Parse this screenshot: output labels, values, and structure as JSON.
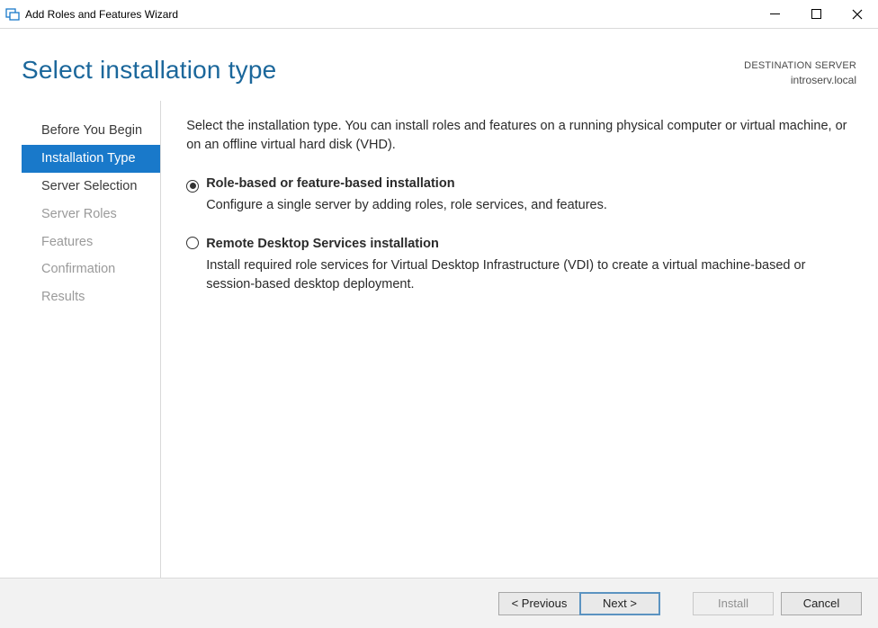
{
  "window": {
    "title": "Add Roles and Features Wizard"
  },
  "header": {
    "page_title": "Select installation type",
    "destination_label": "DESTINATION SERVER",
    "destination_server": "introserv.local"
  },
  "sidebar": {
    "steps": [
      {
        "label": "Before You Begin",
        "state": "enabled"
      },
      {
        "label": "Installation Type",
        "state": "selected"
      },
      {
        "label": "Server Selection",
        "state": "enabled"
      },
      {
        "label": "Server Roles",
        "state": "disabled"
      },
      {
        "label": "Features",
        "state": "disabled"
      },
      {
        "label": "Confirmation",
        "state": "disabled"
      },
      {
        "label": "Results",
        "state": "disabled"
      }
    ]
  },
  "main": {
    "intro": "Select the installation type. You can install roles and features on a running physical computer or virtual machine, or on an offline virtual hard disk (VHD).",
    "options": [
      {
        "title": "Role-based or feature-based installation",
        "desc": "Configure a single server by adding roles, role services, and features.",
        "checked": true
      },
      {
        "title": "Remote Desktop Services installation",
        "desc": "Install required role services for Virtual Desktop Infrastructure (VDI) to create a virtual machine-based or session-based desktop deployment.",
        "checked": false
      }
    ]
  },
  "footer": {
    "previous": "< Previous",
    "next": "Next >",
    "install": "Install",
    "cancel": "Cancel"
  }
}
